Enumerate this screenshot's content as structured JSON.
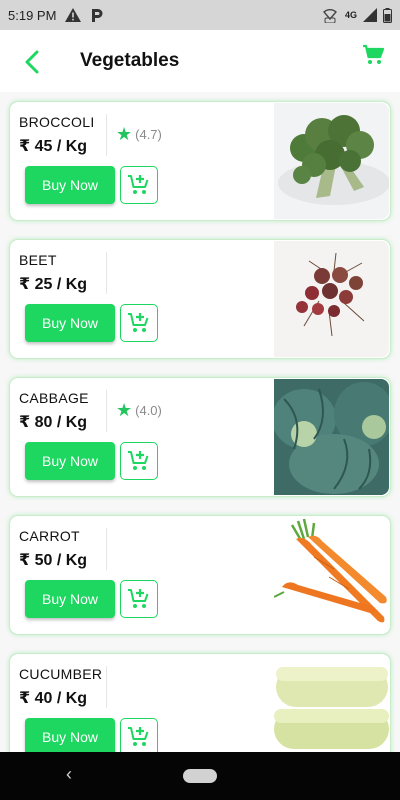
{
  "status_bar": {
    "time": "5:19 PM",
    "network": "4G",
    "icons": [
      "warning-icon",
      "parking-icon",
      "wifi-lte-icon",
      "signal-icon",
      "battery-icon"
    ]
  },
  "header": {
    "title": "Vegetables",
    "back_icon": "chevron-left-icon",
    "cart_icon": "cart-icon"
  },
  "colors": {
    "accent": "#1ed760",
    "star": "#22c55e"
  },
  "products": [
    {
      "name": "BROCCOLI",
      "price": "₹ 45 / Kg",
      "rating": "(4.7)",
      "buy_label": "Buy Now",
      "image": "broccoli"
    },
    {
      "name": "BEET",
      "price": "₹ 25 / Kg",
      "rating": null,
      "buy_label": "Buy Now",
      "image": "beet"
    },
    {
      "name": "CABBAGE",
      "price": "₹ 80 / Kg",
      "rating": "(4.0)",
      "buy_label": "Buy Now",
      "image": "cabbage"
    },
    {
      "name": "CARROT",
      "price": "₹ 50 / Kg",
      "rating": null,
      "buy_label": "Buy Now",
      "image": "carrot"
    },
    {
      "name": "CUCUMBER",
      "price": "₹ 40 / Kg",
      "rating": null,
      "buy_label": "Buy Now",
      "image": "cucumber"
    }
  ]
}
